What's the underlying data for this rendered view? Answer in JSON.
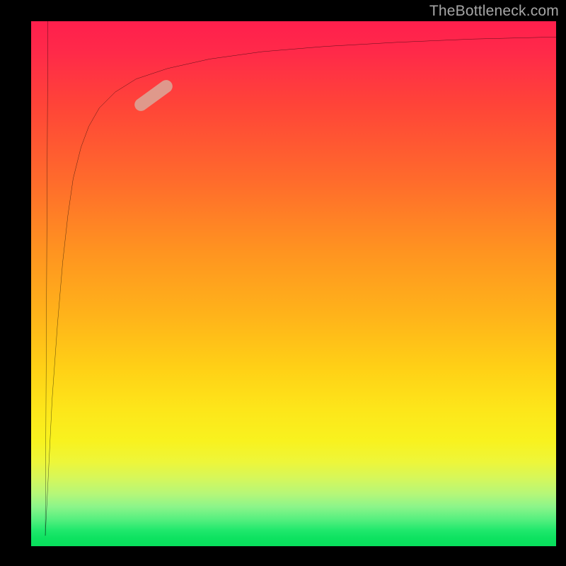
{
  "watermark": "TheBottleneck.com",
  "chart_data": {
    "type": "line",
    "title": "",
    "xlabel": "",
    "ylabel": "",
    "xlim": [
      0,
      100
    ],
    "ylim": [
      0,
      100
    ],
    "grid": false,
    "legend": false,
    "background": "gradient",
    "background_gradient_stops": [
      {
        "pct": 0,
        "color": "#ff1f4d"
      },
      {
        "pct": 30,
        "color": "#ff6a2c"
      },
      {
        "pct": 56,
        "color": "#ffb31a"
      },
      {
        "pct": 80,
        "color": "#f8f21f"
      },
      {
        "pct": 90,
        "color": "#b6f778"
      },
      {
        "pct": 100,
        "color": "#08df5c"
      }
    ],
    "series": [
      {
        "name": "bottleneck-curve",
        "x": [
          1,
          2,
          3,
          4,
          5,
          6,
          7,
          8,
          9,
          10,
          12,
          14,
          16,
          18,
          20,
          24,
          28,
          32,
          38,
          46,
          56,
          68,
          82,
          100
        ],
        "y": [
          2,
          40,
          60,
          70,
          76,
          80,
          82.5,
          84.5,
          86,
          87.2,
          89,
          90.2,
          91.2,
          92,
          92.6,
          93.6,
          94.2,
          94.7,
          95.3,
          95.8,
          96.3,
          96.7,
          97,
          97.3
        ]
      }
    ],
    "highlight_point": {
      "x": 10,
      "y": 87,
      "color": "#dca193",
      "shape": "capsule"
    }
  }
}
